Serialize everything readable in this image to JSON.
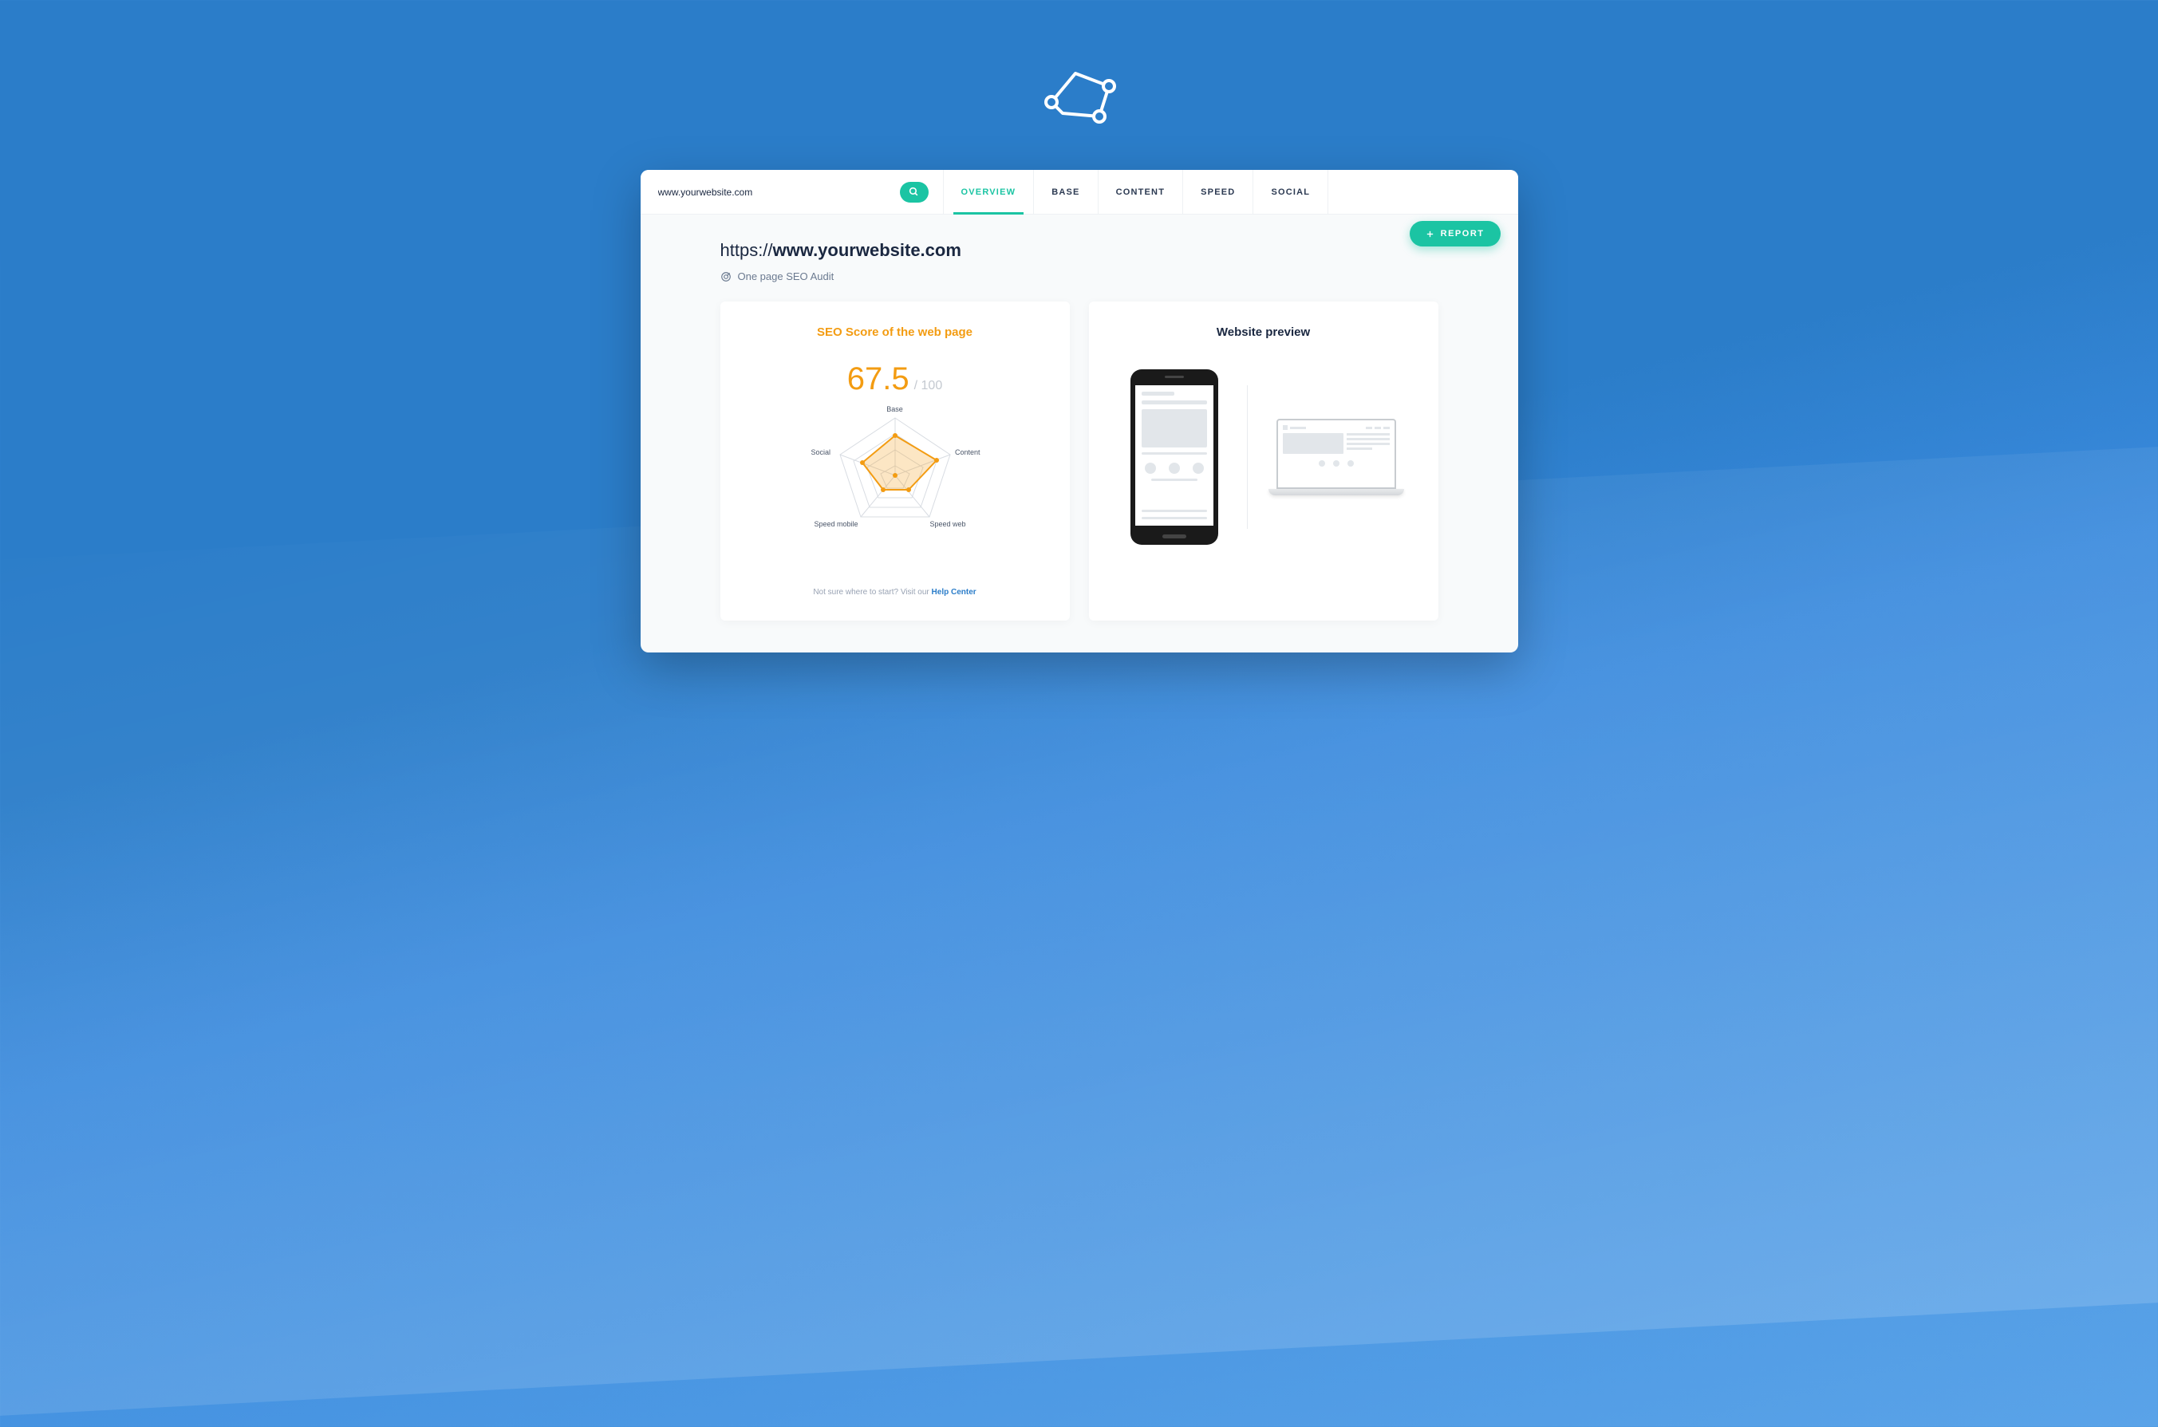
{
  "search": {
    "value": "www.yourwebsite.com"
  },
  "tabs": [
    {
      "label": "OVERVIEW",
      "active": true
    },
    {
      "label": "BASE",
      "active": false
    },
    {
      "label": "CONTENT",
      "active": false
    },
    {
      "label": "SPEED",
      "active": false
    },
    {
      "label": "SOCIAL",
      "active": false
    }
  ],
  "report_button": "REPORT",
  "page": {
    "protocol": "https://",
    "domain": "www.yourwebsite.com",
    "subtitle": "One page SEO Audit"
  },
  "cards": {
    "score": {
      "title": "SEO Score of the web page",
      "value": "67.5",
      "max": "/ 100",
      "help_text": "Not sure where to start? Visit our ",
      "help_link": "Help Center"
    },
    "preview": {
      "title": "Website preview"
    }
  },
  "chart_data": {
    "type": "radar",
    "title": "SEO Score of the web page",
    "categories": [
      "Base",
      "Content",
      "Speed web",
      "Speed mobile",
      "Social"
    ],
    "values": [
      70,
      75,
      40,
      35,
      60
    ],
    "max": 100,
    "overall_score": 67.5
  },
  "colors": {
    "accent": "#1bc4a3",
    "orange": "#f39c12",
    "bg_blue": "#2b7dc9"
  }
}
